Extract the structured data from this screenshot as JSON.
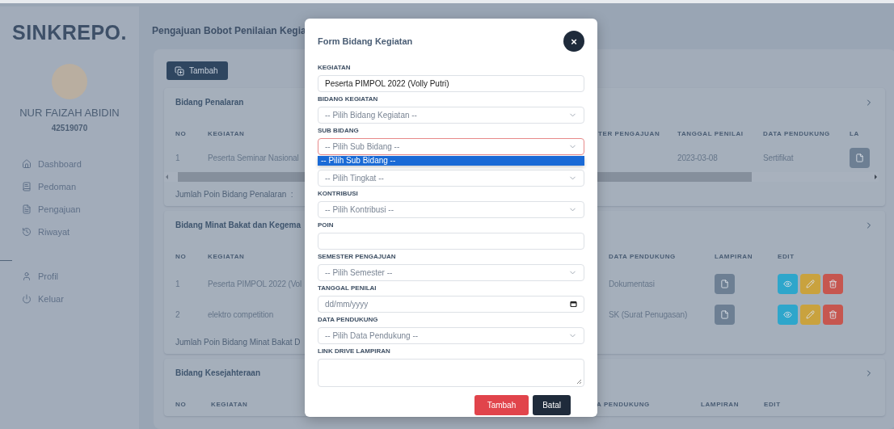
{
  "sidebar": {
    "logo": "SINKREPO.",
    "user": {
      "name": "NUR FAIZAH ABIDIN",
      "id": "42519070"
    },
    "nav": [
      {
        "label": "Dashboard"
      },
      {
        "label": "Pedoman"
      },
      {
        "label": "Pengajuan"
      },
      {
        "label": "Riwayat"
      }
    ],
    "nav_bottom": [
      {
        "label": "Profil"
      },
      {
        "label": "Keluar"
      }
    ]
  },
  "page": {
    "title": "Pengajuan Bobot Penilaian Kegia",
    "add_button": "Tambah"
  },
  "sections": [
    {
      "title": "Bidang Penalaran",
      "columns": [
        "NO",
        "KEGIATAN",
        "TER PENGAJUAN",
        "TANGGAL PENILAI",
        "DATA PENDUKUNG",
        "LA"
      ],
      "rows": [
        {
          "no": "1",
          "kegiatan": "Peserta Seminar Nasional",
          "tanggal": "2023-03-08",
          "pendukung": "Sertifikat",
          "lampiran": true
        }
      ],
      "scrollbar": true,
      "footer": "Jumlah Poin Bidang Penalaran  :"
    },
    {
      "title": "Bidang Minat Bakat dan Kegema",
      "columns": [
        "NO",
        "KEGIATAN",
        "DATA PENDUKUNG",
        "LAMPIRAN",
        "EDIT"
      ],
      "rows": [
        {
          "no": "1",
          "kegiatan": "Peserta PIMPOL 2022 (Vol",
          "pendukung": "Dokumentasi",
          "lampiran": true,
          "edit": true
        },
        {
          "no": "2",
          "kegiatan": "elektro competition",
          "pendukung": "SK (Surat Penugasan)",
          "lampiran": true,
          "edit": true
        }
      ],
      "footer": "Jumlah Poin Bidang Minat Bakat D"
    },
    {
      "title": "Bidang Kesejahteraan",
      "columns": [
        "NO",
        "KEGIATAN",
        "A PENDUKUNG",
        "LAMPIRAN",
        "EDIT"
      ]
    }
  ],
  "modal": {
    "title": "Form Bidang Kegiatan",
    "close": "×",
    "fields": [
      {
        "kind": "text",
        "label": "KEGIATAN",
        "value": "Peserta PIMPOL 2022 (Volly Putri)"
      },
      {
        "kind": "select",
        "label": "BIDANG KEGIATAN",
        "placeholder": "-- Pilih Bidang Kegiatan --",
        "invalid": false
      },
      {
        "kind": "select",
        "label": "SUB BIDANG",
        "placeholder": "-- Pilih Sub Bidang --",
        "invalid": true,
        "expanded": true,
        "options": [
          {
            "label": "-- Pilih Sub Bidang --",
            "selected": true
          }
        ]
      },
      {
        "kind": "select",
        "placeholder": "-- Pilih Tingkat --",
        "invalid": false
      },
      {
        "kind": "select",
        "label": "KONTRIBUSI",
        "placeholder": "-- Pilih Kontribusi --",
        "invalid": false
      },
      {
        "kind": "text",
        "label": "POIN"
      },
      {
        "kind": "select",
        "label": "SEMESTER PENGAJUAN",
        "placeholder": "-- Pilih Semester --",
        "invalid": false
      },
      {
        "kind": "date",
        "label": "TANGGAL PENILAI",
        "placeholder": "dd/mm/yyyy"
      },
      {
        "kind": "select",
        "label": "DATA PENDUKUNG",
        "placeholder": "-- Pilih Data Pendukung --",
        "invalid": false
      },
      {
        "kind": "textarea",
        "label": "LINK DRIVE LAMPIRAN"
      }
    ],
    "buttons": [
      {
        "label": "Tambah",
        "kind": "primary"
      },
      {
        "label": "Batal",
        "kind": "secondary"
      }
    ]
  }
}
